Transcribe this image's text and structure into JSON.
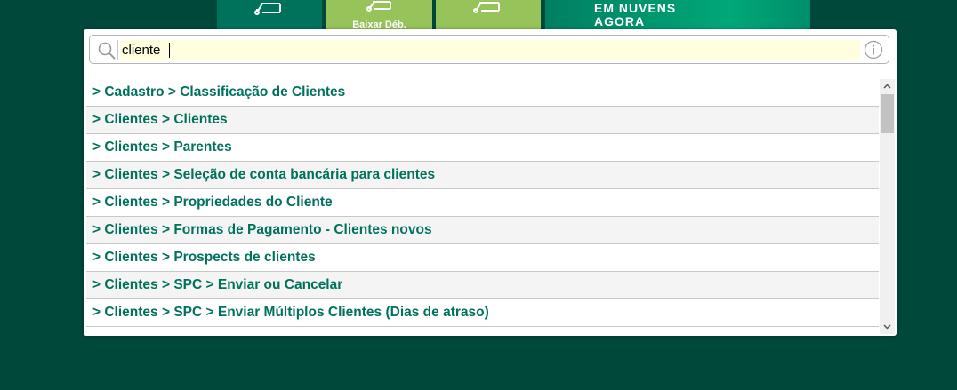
{
  "tiles": [
    {
      "label": ""
    },
    {
      "label": "Baixar Déb."
    },
    {
      "label": ""
    }
  ],
  "promo": {
    "line1": "EM NUVENS",
    "line2": "AGORA"
  },
  "search": {
    "value": "cliente",
    "placeholder": ""
  },
  "results": [
    {
      "label": "> Cadastro > Classificação de Clientes"
    },
    {
      "label": "> Clientes > Clientes"
    },
    {
      "label": "> Clientes > Parentes"
    },
    {
      "label": "> Clientes > Seleção de conta bancária para clientes"
    },
    {
      "label": "> Clientes > Propriedades do Cliente"
    },
    {
      "label": "> Clientes > Formas de Pagamento - Clientes novos"
    },
    {
      "label": "> Clientes > Prospects de clientes"
    },
    {
      "label": "> Clientes > SPC > Enviar ou Cancelar"
    },
    {
      "label": "> Clientes > SPC > Enviar Múltiplos Clientes (Dias de atraso)"
    }
  ],
  "colors": {
    "background": "#00483a",
    "accent": "#00725c",
    "tile_light": "#97c35b",
    "search_highlight": "#ffffe0"
  },
  "icons": {
    "search": "search-icon",
    "info": "info-icon",
    "scroll_up": "chevron-up-icon",
    "scroll_down": "chevron-down-icon"
  }
}
